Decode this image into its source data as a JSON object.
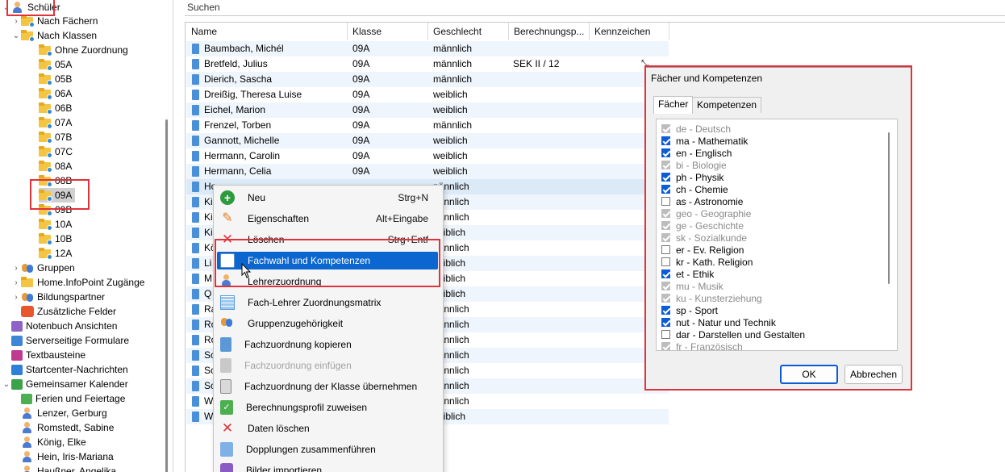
{
  "sidebar": {
    "root": "Schüler",
    "by_subject": "Nach Fächern",
    "by_class": "Nach Klassen",
    "classes": [
      "Ohne Zuordnung",
      "05A",
      "05B",
      "06A",
      "06B",
      "07A",
      "07B",
      "07C",
      "08A",
      "08B",
      "09A",
      "09B",
      "10A",
      "10B",
      "12A"
    ],
    "selected_class": "09A",
    "other_items": [
      "Gruppen",
      "Home.InfoPoint Zugänge",
      "Bildungspartner",
      "Zusätzliche Felder"
    ],
    "top_items": [
      "Notenbuch Ansichten",
      "Serverseitige Formulare",
      "Textbausteine",
      "Startcenter-Nachrichten",
      "Gemeinsamer Kalender"
    ],
    "calendar_items": [
      "Ferien und Feiertage",
      "Lenzer, Gerburg",
      "Romstedt, Sabine",
      "König, Elke",
      "Hein, Iris-Mariana",
      "Haußner, Angelika"
    ]
  },
  "search": {
    "label": "Suchen"
  },
  "grid": {
    "columns": [
      "Name",
      "Klasse",
      "Geschlecht",
      "Berechnungsp...",
      "Kennzeichen"
    ],
    "rows": [
      {
        "name": "Baumbach, Michél",
        "klasse": "09A",
        "geschlecht": "männlich",
        "berechnung": ""
      },
      {
        "name": "Bretfeld, Julius",
        "klasse": "09A",
        "geschlecht": "männlich",
        "berechnung": "SEK II / 12"
      },
      {
        "name": "Dierich, Sascha",
        "klasse": "09A",
        "geschlecht": "männlich",
        "berechnung": ""
      },
      {
        "name": "Dreißig, Theresa Luise",
        "klasse": "09A",
        "geschlecht": "weiblich",
        "berechnung": ""
      },
      {
        "name": "Eichel, Marion",
        "klasse": "09A",
        "geschlecht": "weiblich",
        "berechnung": ""
      },
      {
        "name": "Frenzel, Torben",
        "klasse": "09A",
        "geschlecht": "männlich",
        "berechnung": ""
      },
      {
        "name": "Gannott, Michelle",
        "klasse": "09A",
        "geschlecht": "weiblich",
        "berechnung": ""
      },
      {
        "name": "Hermann, Carolin",
        "klasse": "09A",
        "geschlecht": "weiblich",
        "berechnung": ""
      },
      {
        "name": "Hermann, Celia",
        "klasse": "09A",
        "geschlecht": "weiblich",
        "berechnung": ""
      },
      {
        "name": "Ho",
        "klasse": "",
        "geschlecht": "nännlich",
        "berechnung": ""
      },
      {
        "name": "Ki",
        "klasse": "",
        "geschlecht": "nännlich",
        "berechnung": ""
      },
      {
        "name": "Ki",
        "klasse": "",
        "geschlecht": "nännlich",
        "berechnung": ""
      },
      {
        "name": "Ki",
        "klasse": "",
        "geschlecht": "veiblich",
        "berechnung": ""
      },
      {
        "name": "Kö",
        "klasse": "",
        "geschlecht": "nännlich",
        "berechnung": ""
      },
      {
        "name": "Li",
        "klasse": "",
        "geschlecht": "veiblich",
        "berechnung": ""
      },
      {
        "name": "M",
        "klasse": "",
        "geschlecht": "veiblich",
        "berechnung": ""
      },
      {
        "name": "Q",
        "klasse": "",
        "geschlecht": "veiblich",
        "berechnung": ""
      },
      {
        "name": "Ra",
        "klasse": "",
        "geschlecht": "nännlich",
        "berechnung": ""
      },
      {
        "name": "Ro",
        "klasse": "",
        "geschlecht": "nännlich",
        "berechnung": ""
      },
      {
        "name": "Ro",
        "klasse": "",
        "geschlecht": "nännlich",
        "berechnung": ""
      },
      {
        "name": "Sc",
        "klasse": "",
        "geschlecht": "nännlich",
        "berechnung": ""
      },
      {
        "name": "Sc",
        "klasse": "",
        "geschlecht": "nännlich",
        "berechnung": ""
      },
      {
        "name": "Sc",
        "klasse": "",
        "geschlecht": "nännlich",
        "berechnung": ""
      },
      {
        "name": "W",
        "klasse": "",
        "geschlecht": "nännlich",
        "berechnung": ""
      },
      {
        "name": "W",
        "klasse": "",
        "geschlecht": "veiblich",
        "berechnung": ""
      }
    ]
  },
  "context_menu": {
    "items": [
      {
        "label": "Neu",
        "shortcut": "Strg+N",
        "icon": "plus-circle-icon"
      },
      {
        "label": "Eigenschaften",
        "shortcut": "Alt+Eingabe",
        "icon": "pencil-icon"
      },
      {
        "label": "Löschen",
        "shortcut": "Strg+Entf",
        "icon": "delete-x-icon"
      },
      {
        "label": "Fachwahl und Kompetenzen",
        "shortcut": "",
        "icon": "subject-choice-icon",
        "active": true
      },
      {
        "label": "Lehrerzuordnung",
        "shortcut": "",
        "icon": "teacher-icon"
      },
      {
        "label": "Fach-Lehrer Zuordnungsmatrix",
        "shortcut": "",
        "icon": "matrix-icon"
      },
      {
        "label": "Gruppenzugehörigkeit",
        "shortcut": "",
        "icon": "group-icon"
      },
      {
        "label": "Fachzuordnung kopieren",
        "shortcut": "",
        "icon": "copy-icon"
      },
      {
        "label": "Fachzuordnung einfügen",
        "shortcut": "",
        "icon": "paste-icon",
        "disabled": true
      },
      {
        "label": "Fachzuordnung der Klasse übernehmen",
        "shortcut": "",
        "icon": "import-class-icon"
      },
      {
        "label": "Berechnungsprofil zuweisen",
        "shortcut": "",
        "icon": "calc-profile-icon"
      },
      {
        "label": "Daten löschen",
        "shortcut": "",
        "icon": "delete-data-icon"
      },
      {
        "label": "Dopplungen zusammenführen",
        "shortcut": "",
        "icon": "merge-icon"
      },
      {
        "label": "Bilder importieren",
        "shortcut": "",
        "icon": "camera-icon"
      }
    ]
  },
  "dialog": {
    "title": "Fächer und Kompetenzen",
    "tabs": [
      "Fächer",
      "Kompetenzen"
    ],
    "subjects": [
      {
        "label": "de - Deutsch",
        "checked": true,
        "disabled": true
      },
      {
        "label": "ma - Mathematik",
        "checked": true,
        "disabled": false
      },
      {
        "label": "en - Englisch",
        "checked": true,
        "disabled": false
      },
      {
        "label": "bi - Biologie",
        "checked": true,
        "disabled": true
      },
      {
        "label": "ph - Physik",
        "checked": true,
        "disabled": false
      },
      {
        "label": "ch - Chemie",
        "checked": true,
        "disabled": false
      },
      {
        "label": "as - Astronomie",
        "checked": false,
        "disabled": false
      },
      {
        "label": "geo - Geographie",
        "checked": true,
        "disabled": true
      },
      {
        "label": "ge - Geschichte",
        "checked": true,
        "disabled": true
      },
      {
        "label": "sk - Sozialkunde",
        "checked": true,
        "disabled": true
      },
      {
        "label": "er - Ev. Religion",
        "checked": false,
        "disabled": false
      },
      {
        "label": "kr - Kath. Religion",
        "checked": false,
        "disabled": false
      },
      {
        "label": "et - Ethik",
        "checked": true,
        "disabled": false
      },
      {
        "label": "mu - Musik",
        "checked": true,
        "disabled": true
      },
      {
        "label": "ku - Kunsterziehung",
        "checked": true,
        "disabled": true
      },
      {
        "label": "sp - Sport",
        "checked": true,
        "disabled": false
      },
      {
        "label": "nut - Natur und Technik",
        "checked": true,
        "disabled": false
      },
      {
        "label": "dar - Darstellen und Gestalten",
        "checked": false,
        "disabled": false
      },
      {
        "label": "fr - Französisch",
        "checked": true,
        "disabled": true
      }
    ],
    "ok_label": "OK",
    "cancel_label": "Abbrechen"
  },
  "colors": {
    "highlight_box": "#e0323a",
    "menu_active": "#0b66d0",
    "checkbox": "#0b5cd5"
  }
}
